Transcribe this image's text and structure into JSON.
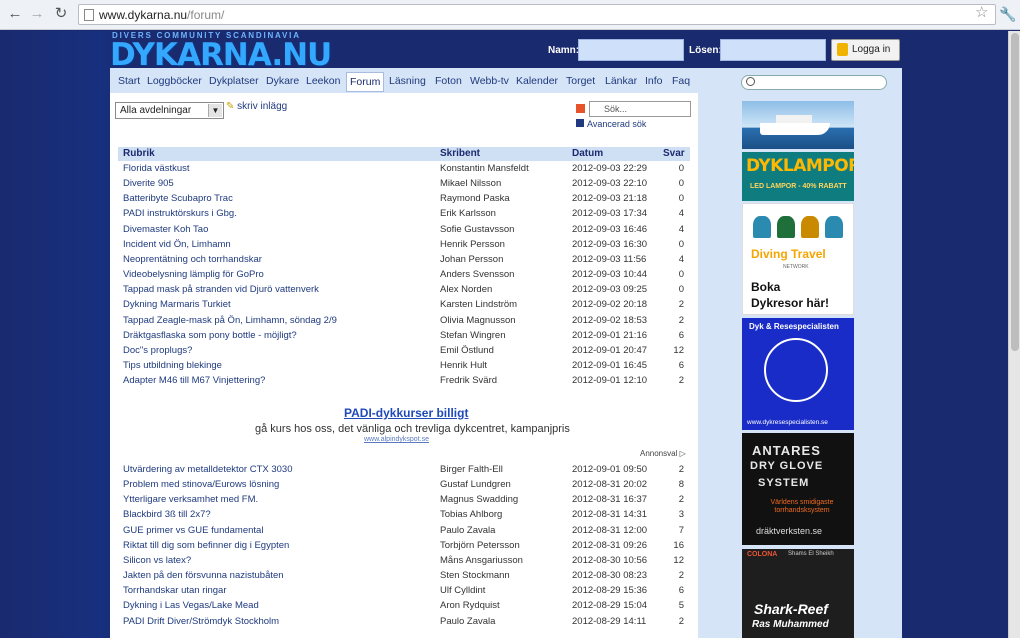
{
  "browser": {
    "url_host": "www.dykarna.nu",
    "url_path": "/forum/"
  },
  "site": {
    "logo_tagline": "DIVERS COMMUNITY SCANDINAVIA",
    "logo_text": "DYKARNA.NU",
    "login": {
      "name_label": "Namn:",
      "password_label": "Lösen:",
      "button_label": "Logga in"
    }
  },
  "nav": [
    "Start",
    "Loggböcker",
    "Dykplatser",
    "Dykare",
    "Leekon",
    "Forum",
    "Läsning",
    "Foton",
    "Webb-tv",
    "Kalender",
    "Torget",
    "Länkar",
    "Info",
    "Faq"
  ],
  "nav_active": "Forum",
  "forum": {
    "section_select": "Alla avdelningar",
    "write_link": "skriv inlägg",
    "search_placeholder": "Sök...",
    "advanced_search": "Avancerad sök",
    "headers": {
      "topic": "Rubrik",
      "author": "Skribent",
      "date": "Datum",
      "replies": "Svar"
    },
    "rows_top": [
      {
        "topic": "Florida västkust",
        "author": "Konstantin Mansfeldt",
        "date": "2012-09-03 22:29",
        "replies": "0"
      },
      {
        "topic": "Diverite 905",
        "author": "Mikael Nilsson",
        "date": "2012-09-03 22:10",
        "replies": "0"
      },
      {
        "topic": "Batteribyte Scubapro Trac",
        "author": "Raymond Paska",
        "date": "2012-09-03 21:18",
        "replies": "0"
      },
      {
        "topic": "PADI instruktörskurs i Gbg.",
        "author": "Erik Karlsson",
        "date": "2012-09-03 17:34",
        "replies": "4"
      },
      {
        "topic": "Divemaster Koh Tao",
        "author": "Sofie Gustavsson",
        "date": "2012-09-03 16:46",
        "replies": "4"
      },
      {
        "topic": "Incident vid Ön, Limhamn",
        "author": "Henrik Persson",
        "date": "2012-09-03 16:30",
        "replies": "0"
      },
      {
        "topic": "Neoprentätning och torrhandskar",
        "author": "Johan Persson",
        "date": "2012-09-03 11:56",
        "replies": "4"
      },
      {
        "topic": "Videobelysning lämplig för GoPro",
        "author": "Anders Svensson",
        "date": "2012-09-03 10:44",
        "replies": "0"
      },
      {
        "topic": "Tappad mask på stranden vid Djurö vattenverk",
        "author": "Alex Norden",
        "date": "2012-09-03 09:25",
        "replies": "0"
      },
      {
        "topic": "Dykning Marmaris Turkiet",
        "author": "Karsten Lindström",
        "date": "2012-09-02 20:18",
        "replies": "2"
      },
      {
        "topic": "Tappad Zeagle-mask på Ön, Limhamn, söndag 2/9",
        "author": "Olivia Magnusson",
        "date": "2012-09-02 18:53",
        "replies": "2"
      },
      {
        "topic": "Dräktgasflaska som pony bottle - möjligt?",
        "author": "Stefan Wingren",
        "date": "2012-09-01 21:16",
        "replies": "6"
      },
      {
        "topic": "Doc\"s proplugs?",
        "author": "Emil Östlund",
        "date": "2012-09-01 20:47",
        "replies": "12"
      },
      {
        "topic": "Tips utbildning blekinge",
        "author": "Henrik Hult",
        "date": "2012-09-01 16:45",
        "replies": "6"
      },
      {
        "topic": "Adapter M46 till M67 Vinjettering?",
        "author": "Fredrik Svärd",
        "date": "2012-09-01 12:10",
        "replies": "2"
      }
    ],
    "ad": {
      "title": "PADI-dykkurser billigt",
      "text": "gå kurs hos oss, det vänliga och trevliga dykcentret, kampanjpris",
      "url": "www.alpindykspot.se",
      "label": "Annonsval"
    },
    "rows_bottom": [
      {
        "topic": "Utvärdering av metalldetektor CTX 3030",
        "author": "Birger Falth-Ell",
        "date": "2012-09-01 09:50",
        "replies": "2"
      },
      {
        "topic": "Problem med stinova/Eurows lösning",
        "author": "Gustaf Lundgren",
        "date": "2012-08-31 20:02",
        "replies": "8"
      },
      {
        "topic": "Ytterligare verksamhet med FM.",
        "author": "Magnus Swadding",
        "date": "2012-08-31 16:37",
        "replies": "2"
      },
      {
        "topic": "Blackbird 3ß till 2x7?",
        "author": "Tobias Ahlborg",
        "date": "2012-08-31 14:31",
        "replies": "3"
      },
      {
        "topic": "GUE primer vs GUE fundamental",
        "author": "Paulo Zavala",
        "date": "2012-08-31 12:00",
        "replies": "7"
      },
      {
        "topic": "Riktat till dig som befinner dig i Egypten",
        "author": "Torbjörn Petersson",
        "date": "2012-08-31 09:26",
        "replies": "16"
      },
      {
        "topic": "Silicon vs latex?",
        "author": "Måns Ansgariusson",
        "date": "2012-08-30 10:56",
        "replies": "12"
      },
      {
        "topic": "Jakten på den försvunna nazistubåten",
        "author": "Sten Stockmann",
        "date": "2012-08-30 08:23",
        "replies": "2"
      },
      {
        "topic": "Torrhandskar utan ringar",
        "author": "Ulf Cylldint",
        "date": "2012-08-29 15:36",
        "replies": "6"
      },
      {
        "topic": "Dykning i Las Vegas/Lake Mead",
        "author": "Aron Rydquist",
        "date": "2012-08-29 15:04",
        "replies": "5"
      },
      {
        "topic": "PADI Drift Diver/Strömdyk Stockholm",
        "author": "Paulo Zavala",
        "date": "2012-08-29 14:11",
        "replies": "2"
      }
    ]
  },
  "sidebar": {
    "banners": {
      "dyklampor": {
        "title": "DYKLAMPOR",
        "sub": "LED LAMPOR - 40% RABATT"
      },
      "diving_travel": {
        "title": "Diving Travel",
        "network": "NETWORK",
        "line1": "Boka",
        "line2": "Dykresor här!"
      },
      "resespecialisten": {
        "title": "Dyk & Resespecialisten",
        "url": "www.dykresespecialisten.se"
      },
      "antares": {
        "l1": "ANTARES",
        "l2": "DRY GLOVE",
        "l3": "SYSTEM",
        "l4": "Världens smidigaste torrhandsksystem",
        "l5": "dräktverksten.se"
      },
      "shark": {
        "brand": "COLONA",
        "sub": "Shams El Sheikh",
        "l1": "Shark-Reef",
        "l2": "Ras Muhammed"
      }
    }
  }
}
